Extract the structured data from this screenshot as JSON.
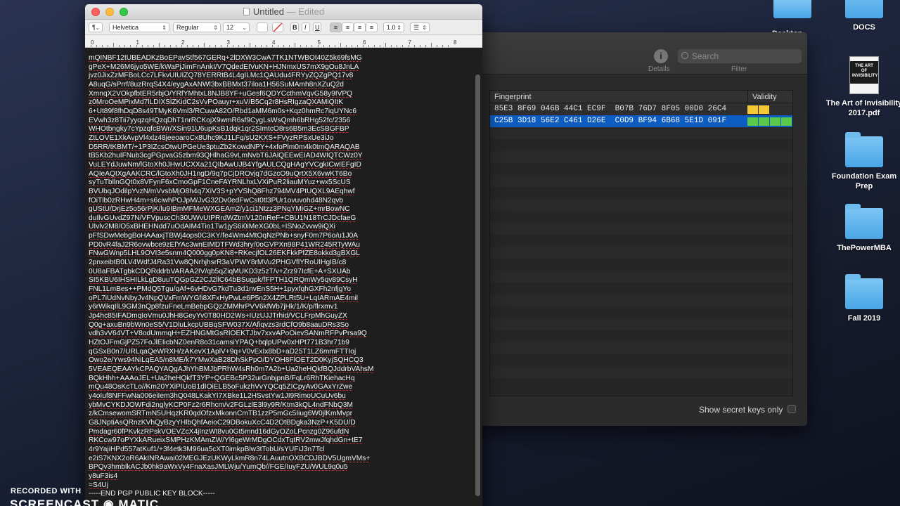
{
  "desktop": {
    "partial_top_label": "Desktop",
    "icons": [
      {
        "label": "DOCS"
      },
      {
        "label": "The Art of Invisibility 2017.pdf",
        "thumb_text": "THE ART OF INVISIBILITY"
      },
      {
        "label": "Foundation Exam Prep"
      },
      {
        "label": "ThePowerMBA"
      },
      {
        "label": "Fall 2019"
      }
    ]
  },
  "keychain": {
    "info_label": "Details",
    "search_placeholder": "Search",
    "filter_label": "Filter",
    "columns": [
      "Fingerprint",
      "Validity"
    ],
    "rows": [
      {
        "fingerprint": "85E3 8F69 046B 44C1 EC9F  B07B 76D7 8F05 00D0 26C4",
        "validity_color": "#f3c935",
        "validity_segments": 2,
        "selected": false
      },
      {
        "fingerprint": "C25B 3D18 56E2 C461 D26E  C0D9 BF94 6B68 5E1D 091F",
        "validity_color": "#5ac84a",
        "validity_segments": 4,
        "selected": true
      }
    ],
    "show_secret_label": "Show secret keys only"
  },
  "textedit": {
    "title": "Untitled",
    "edited": "— Edited",
    "format": {
      "paragraph_style": "¶",
      "font_family": "Helvetica",
      "font_style": "Regular",
      "font_size": "12",
      "bold": "B",
      "italic": "I",
      "underline": "U",
      "line_spacing": "1.0"
    },
    "ruler": [
      "0",
      "1",
      "2",
      "3",
      "4",
      "5",
      "6",
      "7",
      "8"
    ],
    "lines": [
      "mQINBF12tUBEADKzBoEPavStf567GERq+2lDXW3CwA7TK1NTWBOt40Z5k69fsMG",
      "gPeX+M26M6jyo5WE/kWaPjJimFnAnkI/V7QdedEIVuKN+HJNmxUS7mX9gOu8JnLA",
      "jvz0JixZzMFBoLCc7LFkvUIUIZQ78YERRtB4L4gILMc1QAUdu4FRYyZQZgPQ17v8",
      "A8uqG/sPrrf/8uzRrqS4X4/eygAxANWl3bxBBMxt37iloa1H56SuMAmh8nXZuQ2d",
      "XmnqX2VOkpfbtER5rbjO/YRfYMhtxL8NJB8YF+uGesf6QDYCcthmVqvG58y9IVPQ",
      "z0MroOeMPixMd7lLDIXSlZKidC2sVvPOauyr+xuV/B5Cq2r8HsRIgzaQXAMiQItK",
      "6+Ut89f8fhDqD8s49TMyK6Vml3/RCuwA82O/Rbd1aMM6m0s+Kqz0hmRc7iqUYNc6",
      "EVwh3z8Tii7yyqzqHQzqDhT1nrRCKojX9wmR6sf9CygLsWsQmh6bRHg52fc/2356",
      "WHOtbngky7cYpzqfcBWr/XSin91U6upKsB1dqk1qr2SImtcO8rs6B5m3EcSBGFBP",
      "ZtLOVE1XkAvpVl4xlz48jeeoaroCx8Uhc9KJ1LFq/sU2KXS+FVyzRPSxUe3iJo",
      "D5RR/tKBMT/+1P3IZcsOtwUPGeUe3ptuZb2KowdNPY+4xfoPlm0m4k0tmQARAQAB",
      "tB5Kb2huIFNub3cgPGpvaG5zbm93QHlhaG9vLmNvbT6JAlQEEwEIAD4WIQTCWz0Y",
      "VuLEYdJuwNm/lGtoXh0JHwUCXXa21QIbAwUJB4YfgAULCQgHAgYVCgkICwIEFgID",
      "AQIeAQIXgAAKCRC/lGtoXh0JH1ngD/9q7pCjDROvjq7dGzcO9uQrtX5X6vwKT6Bo",
      "syTuTbllnGQt0x8VFynF6xCmoGpF1CneFAYRNLhxLVXiPuR2liauMYuz+wx5ScUS",
      "BVUbqJOdilpYvzN/mVvsbMjO8h4q7XiV3S+pYVShQ8Fhz794MV4PtUQXL9AEqhwf",
      "fOiTlb0zRHwH4m+s6ciwhPOJpM/JvG32Dv0edFwCst0tl3PUr1ovuvohd48N2qvb",
      "gUStU/DrjEz5o56rPjK/lu9IBmMFMeWXGEAm2/y1ci1Ntzz3PNqYMiGZ+mrBowNC",
      "duIlvGUvdZ97N/VFVpuscCh30UWvUtPRrdWZtmV120nReF+CBU1N18TrCJDcfaeG",
      "UIvlv2M8/O5xBHEHNdd7uOdAIM4Tio1Tw1jyS6i0iMeXG0bL+ISNoZvvw9iQXi",
      "pFfSDwMebgBoHAAaxjTBWj4ops0C3KY/fe4Wm4MtOqNzPNb+snyF0m7P6o/u1J0A",
      "PD0vR4faJ2R6ovwbce9zEfYAc3wnEIMDTFWd3hry/0oGVPXn98P41WR245RTyWAu",
      "FNwGWnp5LHL9OVI3e5snm4Q000gg0pKN8+RKecjfOL26EKFkkPfZE8okkd3gBXGL",
      "2pnxeibtB0LV4WdfJ4Ra31Vw8QNrhjhsrR3aVPWY8rMVu2PHGVflYRoUIHgIB/c8",
      "0U8aFBATgbkCDQRddrbVARAA2IV/qb5qZiqMUKD3z5zT/v+Zrz97IcfE+A+SXUAb",
      "SI5KBU6IHSHILkLgD8uuTQGpGZ2CJ2llC64bBSugpk/fFPTH1QRQmWy5qv89CsyH",
      "FNL1LmBes++PMdQ5Tgu/qAf+6vHDvG7kdTu3d1nvEnS5H+1pyxfqhGXFh2nfjgYo",
      "oPL7iUdNvNbyJv4NpQVxFmWYGfi8XFxHyPwLe6P5n2X4ZPLRt5U+LqIARmAE4mil",
      "y6rWikqIlL9GM3nQp8fzuFneLmBebpGQzZMMhrPVV6kfWb7jHk/1/K/p/flrxmv1",
      "Jp4hc85IFADmqIoVmu0JhH8GeyYv0T80HD2Ws+IUzUJJTrhid/VCLFrpMhGuyZX",
      "Q0g+axuBn9bWn0eS5/V1DluLkcpUBBqSFW037X/Afiqvzs3rdCfO9b8aauDRs3So",
      "vdh3vV64VT+V8odUmmqH+EZHNGMtGsRIOEKTJbv7xxvAPoOievSANmRFPvPrsa9Q",
      "HZtOJFmGjPZ57FoJlEIicbNZ0enR8o31camsiYPAQ+bqlpUPw0xHPt771B3hr71b9",
      "qGSxB0n7/URLqaQeWRXH/zAKevX1AplV+9q+V0vExIx8bD+aD25T1LZ6mmFTTIoj",
      "Owo2e/Yws94NiLqEA5/n8ME/k7YMwXaB28DhSkPpO/DYOH8FlOET2D0KyjSQHCQ3",
      "5VEAEQEAAYkCPAQYAQgAJhYhBMJbPRhW4sRh0m7A2b+Ua2heHQkfBQJddrbVAhsM",
      "BQkHhh+AAAoJEL+Ua2heHQkfT3YP+QGEBc5P32urGnbjpnB/FqLr6RhTKiehacHq",
      "mQu48OsKcTLo//Km20YXiPIUoB1dIOiELB5oFukzhVvYQCq5ZICpyAv0GAxYrZwe",
      "y4oIuf8NFFwNa006eiIem3hQ048LKakYI7XBke1L2HSvstYw1JI9RimoUCuUv6bu",
      "ybMvCYKDJOWFdi2nglyKCP0Fz2r6Rhcm/v2FGLzlE3l9y9R/Ktm3kQL4ndFNbQ3M",
      "z/kCmsewomSRTmN5UHqzKR0qdOfzxMkonnCmTB1zzP5mGc5Iiug6W0jlKmMvpr",
      "G8JNptiAsQRnzKVhQyBzyYHlbQhfAeioC29DBokuXcC4D2OtBDgka3NzP+K5DU/D",
      "Pmdagr60fPKvkzRPskVOEVZcX4jInzWt8vu0Gt5mnd16dGyOZoLPcnzg0Z96ufdN",
      "RKCcw97oPYXkARueixSMPHzKMAmZW/Yl6geWrMDgOCdxTqtRV2mwJfqhdGn+tE7",
      "4r9YajiHPd557atKuf1/+3f4etk3M96ua5cXT0imkpBlw3tTobU/sYUFiJ3n7Tcl",
      "e2iS7KNX2oR6AkINRAwai02MEGJEzUKWyLkmR8n74LAuutnOXBCDJBDV5UgmVMs+",
      "BPQv3hmblkACJb0hk9aWxVy4FnaXasJMLWju/YumQb//FGE/IuyFZU/WUL9q0u5",
      "y8uF3is4",
      "=S4Uj",
      "-----END PGP PUBLIC KEY BLOCK-----"
    ]
  },
  "watermark": {
    "recorded_with": "RECORDED WITH",
    "brand": "SCREENCAST ◉ MATIC"
  }
}
